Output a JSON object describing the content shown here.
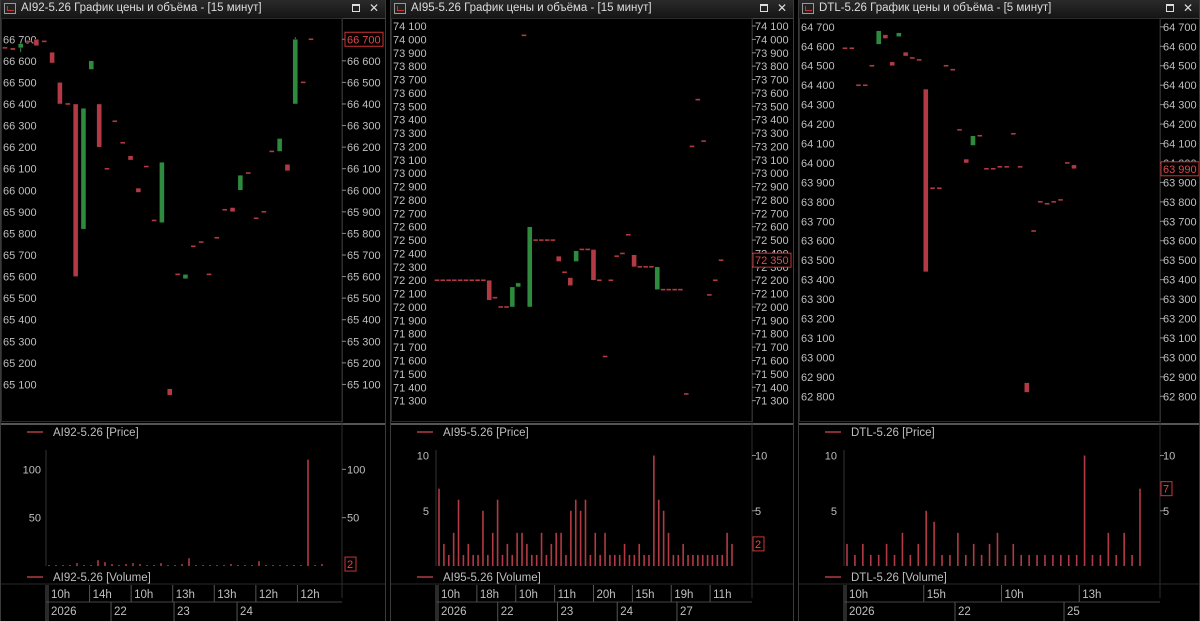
{
  "colors": {
    "up": "#2e8b3e",
    "down": "#b23a44",
    "axis": "#bfbfbf",
    "grid": "#333333",
    "volume": "#b23a44",
    "legend_line": "#b23a44"
  },
  "icons": {
    "window_icon": "chart-window-icon",
    "maximize": "maximize-icon",
    "close": "close-icon"
  },
  "panels": [
    {
      "title": "AI92-5.26 График цены и объёма - [15 минут]",
      "close_glyph": "✕",
      "price_legend": "AI92-5.26 [Price]",
      "volume_legend": "AI92-5.26 [Volume]",
      "last_price_label": "66 700",
      "last_volume_label": "2",
      "time_row1": [
        "10h",
        "14h",
        "10h",
        "13h",
        "13h",
        "12h",
        "12h"
      ],
      "time_row2": [
        "2026",
        "22",
        "23",
        "24"
      ]
    },
    {
      "title": "AI95-5.26 График цены и объёма - [15 минут]",
      "close_glyph": "✕",
      "price_legend": "AI95-5.26 [Price]",
      "volume_legend": "AI95-5.26 [Volume]",
      "last_price_label": "72 350",
      "last_volume_label": "2",
      "time_row1": [
        "10h",
        "18h",
        "10h",
        "11h",
        "20h",
        "15h",
        "19h",
        "11h"
      ],
      "time_row2": [
        "2026",
        "22",
        "23",
        "24",
        "27"
      ]
    },
    {
      "title": "DTL-5.26 График цены и объёма - [5 минут]",
      "close_glyph": "✕",
      "price_legend": "DTL-5.26 [Price]",
      "volume_legend": "DTL-5.26 [Volume]",
      "last_price_label": "63 990",
      "last_volume_label": "7",
      "time_row1": [
        "10h",
        "15h",
        "10h",
        "13h"
      ],
      "time_row2": [
        "2026",
        "22",
        "25"
      ]
    }
  ],
  "chart_data": [
    {
      "type": "candlestick",
      "title": "AI92-5.26 График цены и объёма - [15 минут]",
      "price_axis_ticks": [
        "66 700",
        "66 600",
        "66 500",
        "66 400",
        "66 300",
        "66 200",
        "66 100",
        "66 000",
        "65 900",
        "65 800",
        "65 700",
        "65 600",
        "65 500",
        "65 400",
        "65 300",
        "65 200",
        "65 100"
      ],
      "price_ylim": [
        65000,
        66780
      ],
      "volume_axis_ticks": [
        "100",
        "50"
      ],
      "volume_ylim": [
        0,
        120
      ],
      "candles": [
        {
          "o": 66660,
          "h": 66660,
          "l": 66660,
          "c": 66660
        },
        {
          "o": 66660,
          "h": 66660,
          "l": 66650,
          "c": 66650
        },
        {
          "o": 66660,
          "h": 66680,
          "l": 66640,
          "c": 66680
        },
        {
          "o": 66690,
          "h": 66690,
          "l": 66690,
          "c": 66690
        },
        {
          "o": 66700,
          "h": 66700,
          "l": 66680,
          "c": 66670
        },
        {
          "o": 66690,
          "h": 66690,
          "l": 66690,
          "c": 66690
        },
        {
          "o": 66640,
          "h": 66640,
          "l": 66590,
          "c": 66590
        },
        {
          "o": 66500,
          "h": 66500,
          "l": 66400,
          "c": 66400
        },
        {
          "o": 66400,
          "h": 66400,
          "l": 66400,
          "c": 66400
        },
        {
          "o": 66400,
          "h": 66400,
          "l": 65600,
          "c": 65600
        },
        {
          "o": 65820,
          "h": 66380,
          "l": 65820,
          "c": 66380
        },
        {
          "o": 66560,
          "h": 66600,
          "l": 66560,
          "c": 66600
        },
        {
          "o": 66400,
          "h": 66400,
          "l": 66200,
          "c": 66200
        },
        {
          "o": 66100,
          "h": 66100,
          "l": 66100,
          "c": 66100
        },
        {
          "o": 66320,
          "h": 66320,
          "l": 66320,
          "c": 66320
        },
        {
          "o": 66220,
          "h": 66220,
          "l": 66220,
          "c": 66220
        },
        {
          "o": 66160,
          "h": 66160,
          "l": 66140,
          "c": 66140
        },
        {
          "o": 66010,
          "h": 66010,
          "l": 65990,
          "c": 65990
        },
        {
          "o": 66110,
          "h": 66110,
          "l": 66110,
          "c": 66110
        },
        {
          "o": 65860,
          "h": 65860,
          "l": 65860,
          "c": 65860
        },
        {
          "o": 65850,
          "h": 66130,
          "l": 65850,
          "c": 66130
        },
        {
          "o": 65080,
          "h": 65080,
          "l": 65050,
          "c": 65050
        },
        {
          "o": 65610,
          "h": 65610,
          "l": 65610,
          "c": 65610
        },
        {
          "o": 65590,
          "h": 65610,
          "l": 65590,
          "c": 65610
        },
        {
          "o": 65740,
          "h": 65740,
          "l": 65740,
          "c": 65740
        },
        {
          "o": 65760,
          "h": 65760,
          "l": 65760,
          "c": 65760
        },
        {
          "o": 65610,
          "h": 65610,
          "l": 65610,
          "c": 65610
        },
        {
          "o": 65780,
          "h": 65780,
          "l": 65780,
          "c": 65780
        },
        {
          "o": 65910,
          "h": 65910,
          "l": 65910,
          "c": 65910
        },
        {
          "o": 65920,
          "h": 65920,
          "l": 65900,
          "c": 65900
        },
        {
          "o": 66000,
          "h": 66070,
          "l": 66000,
          "c": 66070
        },
        {
          "o": 66080,
          "h": 66080,
          "l": 66080,
          "c": 66080
        },
        {
          "o": 65870,
          "h": 65870,
          "l": 65870,
          "c": 65870
        },
        {
          "o": 65900,
          "h": 65900,
          "l": 65900,
          "c": 65900
        },
        {
          "o": 66180,
          "h": 66180,
          "l": 66180,
          "c": 66180
        },
        {
          "o": 66180,
          "h": 66240,
          "l": 66180,
          "c": 66240
        },
        {
          "o": 66120,
          "h": 66120,
          "l": 66090,
          "c": 66090
        },
        {
          "o": 66400,
          "h": 66710,
          "l": 66400,
          "c": 66700
        },
        {
          "o": 66500,
          "h": 66500,
          "l": 66500,
          "c": 66500
        },
        {
          "o": 66700,
          "h": 66700,
          "l": 66700,
          "c": 66700
        }
      ],
      "volumes": [
        1,
        1,
        1,
        1,
        3,
        1,
        1,
        6,
        4,
        2,
        1,
        2,
        3,
        2,
        1,
        1,
        3,
        1,
        1,
        2,
        8,
        1,
        1,
        1,
        1,
        1,
        2,
        1,
        1,
        1,
        5,
        1,
        1,
        1,
        1,
        1,
        1,
        110,
        1,
        2
      ]
    },
    {
      "type": "candlestick",
      "title": "AI95-5.26 График цены и объёма - [15 минут]",
      "price_axis_ticks": [
        "74 100",
        "74 000",
        "73 900",
        "73 800",
        "73 700",
        "73 600",
        "73 500",
        "73 400",
        "73 300",
        "73 200",
        "73 100",
        "73 000",
        "72 900",
        "72 800",
        "72 700",
        "72 600",
        "72 500",
        "72 400",
        "72 300",
        "72 200",
        "72 100",
        "72 000",
        "71 900",
        "71 800",
        "71 700",
        "71 600",
        "71 500",
        "71 400",
        "71 300"
      ],
      "price_ylim": [
        71260,
        74130
      ],
      "volume_axis_ticks": [
        "10",
        "5"
      ],
      "volume_ylim": [
        0,
        10.5
      ],
      "candles": [
        {
          "o": 72200,
          "h": 72200,
          "l": 72200,
          "c": 72200
        },
        {
          "o": 72200,
          "h": 72200,
          "l": 72200,
          "c": 72200
        },
        {
          "o": 72200,
          "h": 72200,
          "l": 72200,
          "c": 72200
        },
        {
          "o": 72200,
          "h": 72200,
          "l": 72200,
          "c": 72200
        },
        {
          "o": 72200,
          "h": 72200,
          "l": 72200,
          "c": 72200
        },
        {
          "o": 72200,
          "h": 72200,
          "l": 72200,
          "c": 72200
        },
        {
          "o": 72200,
          "h": 72200,
          "l": 72200,
          "c": 72200
        },
        {
          "o": 72200,
          "h": 72200,
          "l": 72200,
          "c": 72200
        },
        {
          "o": 72200,
          "h": 72200,
          "l": 72200,
          "c": 72200
        },
        {
          "o": 72200,
          "h": 72200,
          "l": 72050,
          "c": 72050
        },
        {
          "o": 72070,
          "h": 72070,
          "l": 72060,
          "c": 72060
        },
        {
          "o": 72000,
          "h": 72000,
          "l": 72000,
          "c": 72000
        },
        {
          "o": 72000,
          "h": 72000,
          "l": 72000,
          "c": 72000
        },
        {
          "o": 72000,
          "h": 72150,
          "l": 72000,
          "c": 72150
        },
        {
          "o": 72150,
          "h": 72180,
          "l": 72150,
          "c": 72180
        },
        {
          "o": 74030,
          "h": 74030,
          "l": 74030,
          "c": 74030
        },
        {
          "o": 72000,
          "h": 72600,
          "l": 72000,
          "c": 72600
        },
        {
          "o": 72500,
          "h": 72500,
          "l": 72500,
          "c": 72500
        },
        {
          "o": 72500,
          "h": 72500,
          "l": 72500,
          "c": 72500
        },
        {
          "o": 72500,
          "h": 72500,
          "l": 72500,
          "c": 72500
        },
        {
          "o": 72500,
          "h": 72500,
          "l": 72500,
          "c": 72500
        },
        {
          "o": 72380,
          "h": 72380,
          "l": 72340,
          "c": 72340
        },
        {
          "o": 72260,
          "h": 72260,
          "l": 72260,
          "c": 72260
        },
        {
          "o": 72220,
          "h": 72220,
          "l": 72160,
          "c": 72160
        },
        {
          "o": 72340,
          "h": 72420,
          "l": 72340,
          "c": 72420
        },
        {
          "o": 72430,
          "h": 72430,
          "l": 72430,
          "c": 72430
        },
        {
          "o": 72430,
          "h": 72430,
          "l": 72430,
          "c": 72430
        },
        {
          "o": 72430,
          "h": 72430,
          "l": 72200,
          "c": 72200
        },
        {
          "o": 72200,
          "h": 72200,
          "l": 72200,
          "c": 72200
        },
        {
          "o": 71630,
          "h": 71630,
          "l": 71630,
          "c": 71630
        },
        {
          "o": 72200,
          "h": 72200,
          "l": 72200,
          "c": 72200
        },
        {
          "o": 72380,
          "h": 72380,
          "l": 72380,
          "c": 72380
        },
        {
          "o": 72400,
          "h": 72400,
          "l": 72400,
          "c": 72400
        },
        {
          "o": 72540,
          "h": 72540,
          "l": 72540,
          "c": 72540
        },
        {
          "o": 72390,
          "h": 72390,
          "l": 72300,
          "c": 72300
        },
        {
          "o": 72300,
          "h": 72300,
          "l": 72300,
          "c": 72300
        },
        {
          "o": 72300,
          "h": 72300,
          "l": 72300,
          "c": 72300
        },
        {
          "o": 72300,
          "h": 72300,
          "l": 72300,
          "c": 72300
        },
        {
          "o": 72130,
          "h": 72300,
          "l": 72130,
          "c": 72300
        },
        {
          "o": 72130,
          "h": 72130,
          "l": 72130,
          "c": 72130
        },
        {
          "o": 72130,
          "h": 72130,
          "l": 72130,
          "c": 72130
        },
        {
          "o": 72130,
          "h": 72130,
          "l": 72130,
          "c": 72130
        },
        {
          "o": 72130,
          "h": 72130,
          "l": 72130,
          "c": 72130
        },
        {
          "o": 71350,
          "h": 71350,
          "l": 71350,
          "c": 71350
        },
        {
          "o": 73200,
          "h": 73200,
          "l": 73200,
          "c": 73200
        },
        {
          "o": 73550,
          "h": 73550,
          "l": 73550,
          "c": 73550
        },
        {
          "o": 73240,
          "h": 73240,
          "l": 73240,
          "c": 73240
        },
        {
          "o": 72090,
          "h": 72090,
          "l": 72090,
          "c": 72090
        },
        {
          "o": 72200,
          "h": 72200,
          "l": 72200,
          "c": 72200
        },
        {
          "o": 72350,
          "h": 72350,
          "l": 72350,
          "c": 72350
        }
      ],
      "volumes": [
        7,
        2,
        1,
        3,
        6,
        1,
        2,
        1,
        1,
        5,
        1,
        3,
        6,
        1,
        2,
        1,
        3,
        3,
        2,
        1,
        1,
        3,
        1,
        2,
        3,
        3,
        1,
        5,
        6,
        5,
        6,
        1,
        3,
        1,
        3,
        1,
        1,
        1,
        2,
        1,
        1,
        2,
        1,
        1,
        10,
        6,
        5,
        3,
        1,
        1,
        2,
        1,
        1,
        1,
        1,
        1,
        1,
        1,
        1,
        3,
        2
      ]
    },
    {
      "type": "candlestick",
      "title": "DTL-5.26 График цены и объёма - [5 минут]",
      "price_axis_ticks": [
        "64 700",
        "64 600",
        "64 500",
        "64 400",
        "64 300",
        "64 200",
        "64 100",
        "64 000",
        "63 900",
        "63 800",
        "63 700",
        "63 600",
        "63 500",
        "63 400",
        "63 300",
        "63 200",
        "63 100",
        "63 000",
        "62 900",
        "62 800"
      ],
      "price_ylim": [
        62750,
        64725
      ],
      "volume_axis_ticks": [
        "10",
        "5"
      ],
      "volume_ylim": [
        0,
        10.5
      ],
      "candles": [
        {
          "o": 64590,
          "h": 64590,
          "l": 64590,
          "c": 64590
        },
        {
          "o": 64590,
          "h": 64590,
          "l": 64590,
          "c": 64590
        },
        {
          "o": 64400,
          "h": 64400,
          "l": 64400,
          "c": 64400
        },
        {
          "o": 64400,
          "h": 64400,
          "l": 64400,
          "c": 64400
        },
        {
          "o": 64500,
          "h": 64500,
          "l": 64500,
          "c": 64500
        },
        {
          "o": 64610,
          "h": 64680,
          "l": 64610,
          "c": 64680
        },
        {
          "o": 64660,
          "h": 64660,
          "l": 64640,
          "c": 64640
        },
        {
          "o": 64520,
          "h": 64520,
          "l": 64500,
          "c": 64500
        },
        {
          "o": 64650,
          "h": 64670,
          "l": 64650,
          "c": 64670
        },
        {
          "o": 64570,
          "h": 64570,
          "l": 64550,
          "c": 64550
        },
        {
          "o": 64540,
          "h": 64540,
          "l": 64540,
          "c": 64540
        },
        {
          "o": 64530,
          "h": 64530,
          "l": 64530,
          "c": 64530
        },
        {
          "o": 64380,
          "h": 64380,
          "l": 63440,
          "c": 63440
        },
        {
          "o": 63870,
          "h": 63870,
          "l": 63870,
          "c": 63870
        },
        {
          "o": 63870,
          "h": 63870,
          "l": 63870,
          "c": 63870
        },
        {
          "o": 64500,
          "h": 64500,
          "l": 64500,
          "c": 64500
        },
        {
          "o": 64480,
          "h": 64480,
          "l": 64480,
          "c": 64480
        },
        {
          "o": 64170,
          "h": 64170,
          "l": 64170,
          "c": 64170
        },
        {
          "o": 64020,
          "h": 64020,
          "l": 64000,
          "c": 64000
        },
        {
          "o": 64090,
          "h": 64140,
          "l": 64090,
          "c": 64140
        },
        {
          "o": 64140,
          "h": 64140,
          "l": 64140,
          "c": 64140
        },
        {
          "o": 63970,
          "h": 63970,
          "l": 63970,
          "c": 63970
        },
        {
          "o": 63970,
          "h": 63970,
          "l": 63970,
          "c": 63970
        },
        {
          "o": 63980,
          "h": 63980,
          "l": 63980,
          "c": 63980
        },
        {
          "o": 63980,
          "h": 63980,
          "l": 63980,
          "c": 63980
        },
        {
          "o": 64150,
          "h": 64150,
          "l": 64150,
          "c": 64150
        },
        {
          "o": 63980,
          "h": 63980,
          "l": 63980,
          "c": 63980
        },
        {
          "o": 62870,
          "h": 62870,
          "l": 62820,
          "c": 62820
        },
        {
          "o": 63650,
          "h": 63650,
          "l": 63650,
          "c": 63650
        },
        {
          "o": 63800,
          "h": 63800,
          "l": 63800,
          "c": 63800
        },
        {
          "o": 63790,
          "h": 63790,
          "l": 63790,
          "c": 63790
        },
        {
          "o": 63800,
          "h": 63800,
          "l": 63800,
          "c": 63800
        },
        {
          "o": 63810,
          "h": 63810,
          "l": 63810,
          "c": 63810
        },
        {
          "o": 64000,
          "h": 64000,
          "l": 64000,
          "c": 64000
        },
        {
          "o": 63990,
          "h": 63990,
          "l": 63970,
          "c": 63970
        }
      ],
      "volumes": [
        2,
        1,
        2,
        1,
        1,
        2,
        1,
        3,
        1,
        2,
        5,
        4,
        1,
        1,
        3,
        1,
        2,
        1,
        2,
        3,
        1,
        2,
        1,
        1,
        1,
        1,
        1,
        1,
        1,
        1,
        10,
        1,
        1,
        3,
        1,
        3,
        1,
        7
      ]
    }
  ]
}
